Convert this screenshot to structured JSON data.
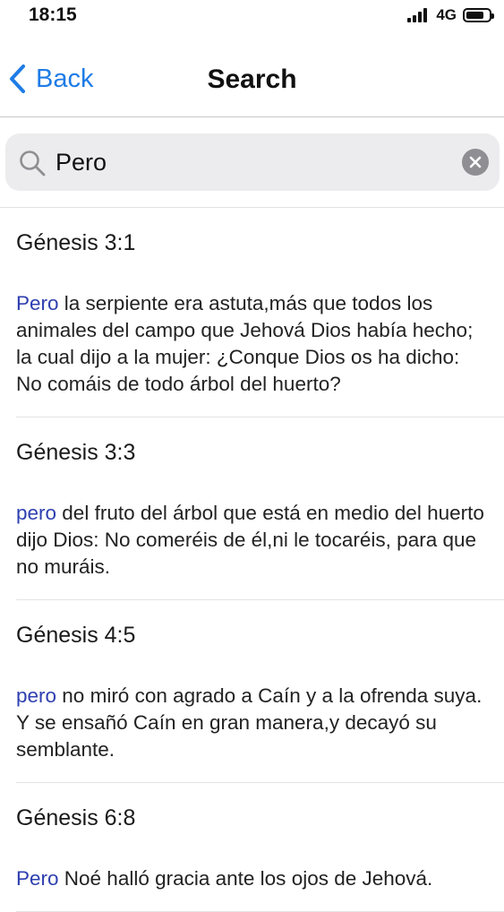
{
  "status": {
    "time": "18:15",
    "network": "4G",
    "battery_level": 0.8
  },
  "nav": {
    "back_label": "Back",
    "title": "Search"
  },
  "search": {
    "value": "Pero",
    "icon": "magnifier-icon",
    "clear_icon": "clear-x-icon"
  },
  "results": [
    {
      "ref": "Génesis 3:1",
      "match": "Pero",
      "text": " la serpiente era astuta,más que todos los animales del campo que Jehová Dios había hecho; la cual dijo a la mujer: ¿Conque Dios os ha dicho: No comáis de todo árbol del huerto?"
    },
    {
      "ref": "Génesis 3:3",
      "match": "pero",
      "text": " del fruto del árbol que está en medio del huerto dijo Dios: No comeréis de él,ni le tocaréis, para que no muráis."
    },
    {
      "ref": "Génesis 4:5",
      "match": "pero",
      "text": " no miró con agrado a Caín y a la ofrenda suya. Y se ensañó Caín en gran manera,y decayó su semblante."
    },
    {
      "ref": "Génesis 6:8",
      "match": "Pero",
      "text": " Noé halló gracia ante los ojos de Jehová."
    }
  ],
  "colors": {
    "accent": "#1f7ce6",
    "highlight": "#2e3fb0",
    "search_bg": "#ececee"
  }
}
